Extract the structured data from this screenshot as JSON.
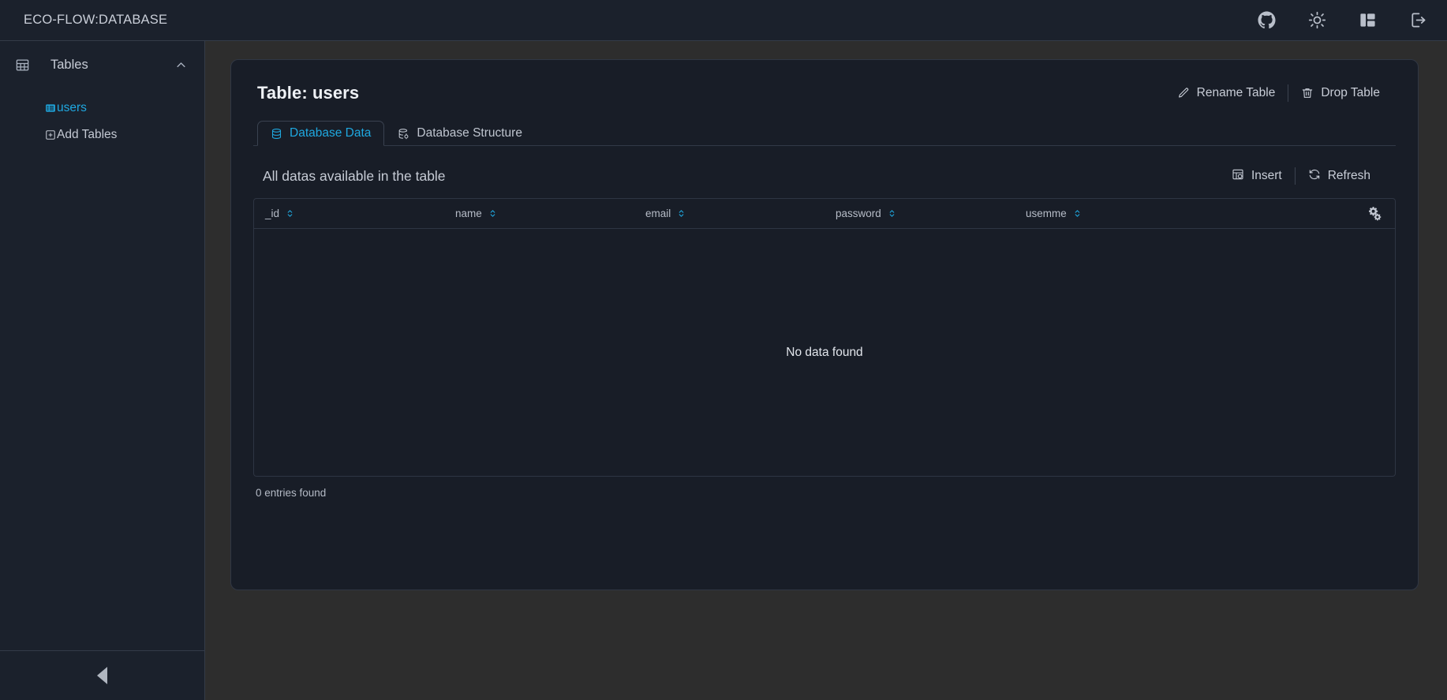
{
  "topbar": {
    "brand": "ECO-FLOW:DATABASE",
    "actions": [
      {
        "name": "github-icon",
        "label": "GitHub"
      },
      {
        "name": "sun-icon",
        "label": "Toggle theme"
      },
      {
        "name": "layout-panel-icon",
        "label": "Toggle panel"
      },
      {
        "name": "logout-icon",
        "label": "Logout"
      }
    ]
  },
  "sidebar": {
    "section_label": "Tables",
    "section_icon": "table-icon",
    "chevron_icon": "chevron-up-icon",
    "items": [
      {
        "label": "users",
        "icon": "table-list-icon",
        "active": true
      },
      {
        "label": "Add Tables",
        "icon": "plus-box-icon",
        "active": false
      }
    ],
    "collapse_icon": "triangle-left-icon"
  },
  "card": {
    "title": "Table: users",
    "actions": [
      {
        "label": "Rename Table",
        "icon": "pencil-icon"
      },
      {
        "label": "Drop Table",
        "icon": "trash-icon"
      }
    ],
    "tabs": [
      {
        "label": "Database Data",
        "icon": "database-icon",
        "active": true
      },
      {
        "label": "Database Structure",
        "icon": "database-gear-icon",
        "active": false
      }
    ],
    "sub_title": "All datas available in the table",
    "sub_actions": [
      {
        "label": "Insert",
        "icon": "table-insert-icon"
      },
      {
        "label": "Refresh",
        "icon": "refresh-icon"
      }
    ],
    "table": {
      "columns": [
        "_id",
        "name",
        "email",
        "password",
        "usemme"
      ],
      "settings_icon": "gears-icon",
      "rows": [],
      "empty_text": "No data found",
      "entries_text": "0 entries found"
    }
  },
  "colors": {
    "accent": "#1fa8e0",
    "card_bg": "#181d27",
    "page_bg": "#2d2d2d",
    "panel_bg": "#1b212c",
    "text": "#c8cdd7"
  }
}
